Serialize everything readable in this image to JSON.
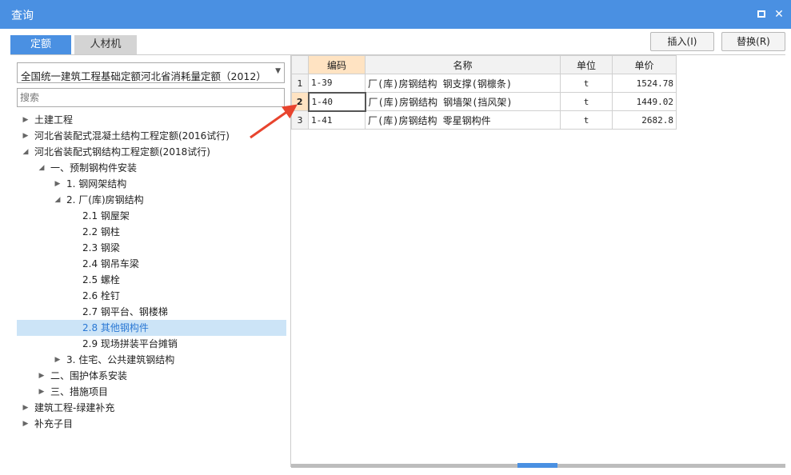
{
  "window": {
    "title": "查询"
  },
  "tabs": [
    {
      "label": "定额",
      "active": true
    },
    {
      "label": "人材机",
      "active": false
    }
  ],
  "buttons": {
    "insert": "插入(I)",
    "replace": "替换(R)"
  },
  "left": {
    "select_value": "全国统一建筑工程基础定额河北省消耗量定额（2012）",
    "search_placeholder": "搜索",
    "tree": [
      {
        "label": "土建工程",
        "level": 0,
        "state": "collapsed"
      },
      {
        "label": "河北省装配式混凝土结构工程定额(2016试行)",
        "level": 0,
        "state": "collapsed"
      },
      {
        "label": "河北省装配式钢结构工程定额(2018试行)",
        "level": 0,
        "state": "expanded"
      },
      {
        "label": "一、预制钢构件安装",
        "level": 1,
        "state": "expanded"
      },
      {
        "label": "1. 钢网架结构",
        "level": 2,
        "state": "collapsed"
      },
      {
        "label": "2. 厂(库)房钢结构",
        "level": 2,
        "state": "expanded"
      },
      {
        "label": "2.1 钢屋架",
        "level": 3,
        "state": "leaf"
      },
      {
        "label": "2.2 钢柱",
        "level": 3,
        "state": "leaf"
      },
      {
        "label": "2.3 钢梁",
        "level": 3,
        "state": "leaf"
      },
      {
        "label": "2.4 钢吊车梁",
        "level": 3,
        "state": "leaf"
      },
      {
        "label": "2.5 螺栓",
        "level": 3,
        "state": "leaf"
      },
      {
        "label": "2.6 栓钉",
        "level": 3,
        "state": "leaf"
      },
      {
        "label": "2.7 钢平台、钢楼梯",
        "level": 3,
        "state": "leaf"
      },
      {
        "label": "2.8 其他钢构件",
        "level": 3,
        "state": "leaf",
        "selected": true
      },
      {
        "label": "2.9 现场拼装平台摊销",
        "level": 3,
        "state": "leaf"
      },
      {
        "label": "3. 住宅、公共建筑钢结构",
        "level": 2,
        "state": "collapsed"
      },
      {
        "label": "二、围护体系安装",
        "level": 1,
        "state": "collapsed"
      },
      {
        "label": "三、措施项目",
        "level": 1,
        "state": "collapsed"
      },
      {
        "label": "建筑工程-绿建补充",
        "level": 0,
        "state": "collapsed"
      },
      {
        "label": "补充子目",
        "level": 0,
        "state": "collapsed"
      }
    ]
  },
  "grid": {
    "headers": {
      "code": "编码",
      "name": "名称",
      "unit": "单位",
      "price": "单价"
    },
    "rows": [
      {
        "num": "1",
        "code": "1-39",
        "name": "厂(库)房钢结构 钢支撑(钢檩条)",
        "unit": "t",
        "price": "1524.78"
      },
      {
        "num": "2",
        "code": "1-40",
        "name": "厂(库)房钢结构 钢墙架(挡风架)",
        "unit": "t",
        "price": "1449.02",
        "active": true
      },
      {
        "num": "3",
        "code": "1-41",
        "name": "厂(库)房钢结构 零星钢构件",
        "unit": "t",
        "price": "2682.8"
      }
    ]
  },
  "colors": {
    "accent": "#4a90e2",
    "selection": "#cce4f7",
    "active_header": "#ffe3c2",
    "arrow": "#e8442e"
  },
  "icons": {
    "expand": "triangle-right",
    "collapse": "triangle-down-left",
    "dropdown": "triangle-down"
  }
}
